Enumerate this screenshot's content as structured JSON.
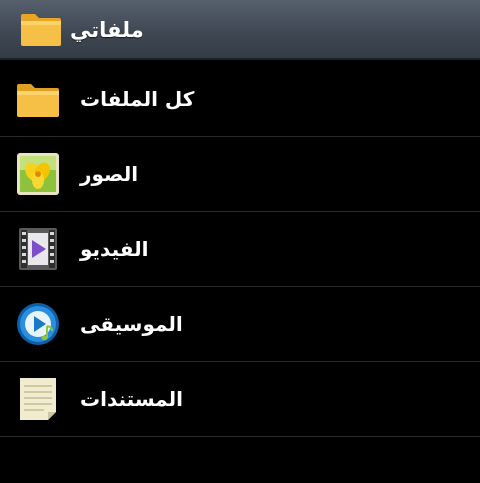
{
  "header": {
    "title": "ملفاتي",
    "icon": "folder-icon"
  },
  "items": [
    {
      "label": "كل الملفات",
      "icon": "folder-icon"
    },
    {
      "label": "الصور",
      "icon": "image-icon"
    },
    {
      "label": "الفيديو",
      "icon": "video-icon"
    },
    {
      "label": "الموسيقى",
      "icon": "music-icon"
    },
    {
      "label": "المستندات",
      "icon": "document-icon"
    }
  ],
  "colors": {
    "background": "#000000",
    "header": "#3f4853",
    "divider": "#2a2a2a",
    "folder": "#f4b63c",
    "video": "#7b4fc9",
    "music": "#1a78c8"
  }
}
